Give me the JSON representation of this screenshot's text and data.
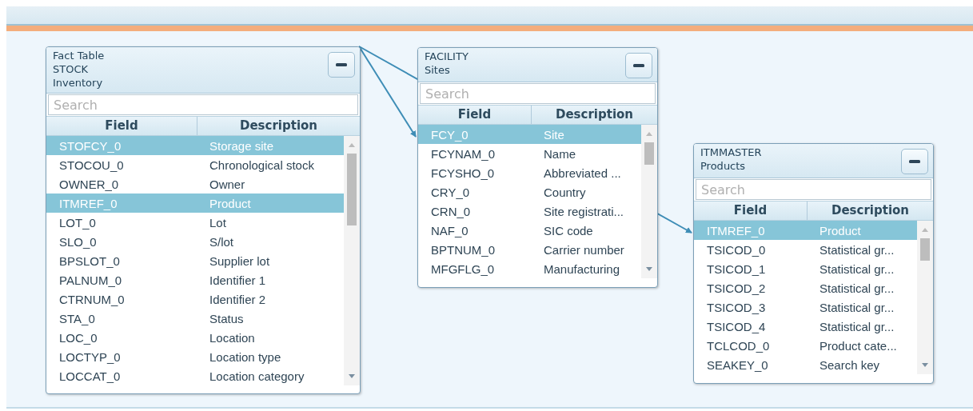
{
  "tables": [
    {
      "title_lines": [
        "Fact Table",
        "STOCK",
        "Inventory"
      ],
      "search": {
        "placeholder": "Search"
      },
      "columns": [
        "Field",
        "Description"
      ],
      "rows": [
        {
          "field": "STOFCY_0",
          "description": "Storage site",
          "selected": true
        },
        {
          "field": "STOCOU_0",
          "description": "Chronological stock",
          "selected": false
        },
        {
          "field": "OWNER_0",
          "description": "Owner",
          "selected": false
        },
        {
          "field": "ITMREF_0",
          "description": "Product",
          "selected": true
        },
        {
          "field": "LOT_0",
          "description": "Lot",
          "selected": false
        },
        {
          "field": "SLO_0",
          "description": "S/lot",
          "selected": false
        },
        {
          "field": "BPSLOT_0",
          "description": "Supplier lot",
          "selected": false
        },
        {
          "field": "PALNUM_0",
          "description": "Identifier 1",
          "selected": false
        },
        {
          "field": "CTRNUM_0",
          "description": "Identifier 2",
          "selected": false
        },
        {
          "field": "STA_0",
          "description": "Status",
          "selected": false
        },
        {
          "field": "LOC_0",
          "description": "Location",
          "selected": false
        },
        {
          "field": "LOCTYP_0",
          "description": "Location type",
          "selected": false
        },
        {
          "field": "LOCCAT_0",
          "description": "Location category",
          "selected": false
        }
      ]
    },
    {
      "title_lines": [
        "FACILITY",
        "Sites"
      ],
      "search": {
        "placeholder": "Search"
      },
      "columns": [
        "Field",
        "Description"
      ],
      "rows": [
        {
          "field": "FCY_0",
          "description": "Site",
          "selected": true
        },
        {
          "field": "FCYNAM_0",
          "description": "Name",
          "selected": false
        },
        {
          "field": "FCYSHO_0",
          "description": "Abbreviated ...",
          "selected": false
        },
        {
          "field": "CRY_0",
          "description": "Country",
          "selected": false
        },
        {
          "field": "CRN_0",
          "description": "Site registrati...",
          "selected": false
        },
        {
          "field": "NAF_0",
          "description": "SIC code",
          "selected": false
        },
        {
          "field": "BPTNUM_0",
          "description": "Carrier number",
          "selected": false
        },
        {
          "field": "MFGFLG_0",
          "description": "Manufacturing",
          "selected": false
        }
      ]
    },
    {
      "title_lines": [
        "ITMMASTER",
        "Products"
      ],
      "search": {
        "placeholder": "Search"
      },
      "columns": [
        "Field",
        "Description"
      ],
      "rows": [
        {
          "field": "ITMREF_0",
          "description": "Product",
          "selected": true
        },
        {
          "field": "TSICOD_0",
          "description": "Statistical gr...",
          "selected": false
        },
        {
          "field": "TSICOD_1",
          "description": "Statistical gr...",
          "selected": false
        },
        {
          "field": "TSICOD_2",
          "description": "Statistical gr...",
          "selected": false
        },
        {
          "field": "TSICOD_3",
          "description": "Statistical gr...",
          "selected": false
        },
        {
          "field": "TSICOD_4",
          "description": "Statistical gr...",
          "selected": false
        },
        {
          "field": "TCLCOD_0",
          "description": "Product cate...",
          "selected": false
        },
        {
          "field": "SEAKEY_0",
          "description": "Search key",
          "selected": false
        }
      ]
    }
  ]
}
